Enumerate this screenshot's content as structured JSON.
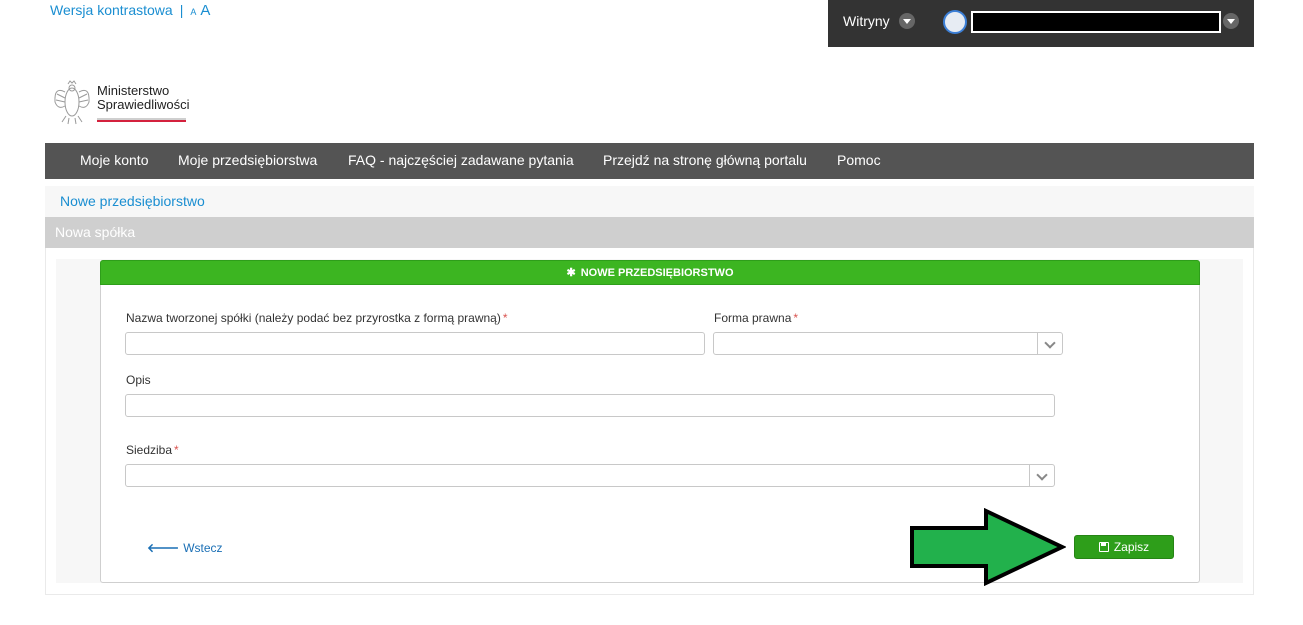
{
  "accessibility": {
    "contrast_label": "Wersja kontrastowa",
    "separator": "|",
    "font_small": "A",
    "font_large": "A"
  },
  "userbar": {
    "sites_label": "Witryny"
  },
  "logo": {
    "line1": "Ministerstwo",
    "line2": "Sprawiedliwości"
  },
  "nav": {
    "items": [
      "Moje konto",
      "Moje przedsiębiorstwa",
      "FAQ - najczęściej zadawane pytania",
      "Przejdź na stronę główną portalu",
      "Pomoc"
    ]
  },
  "breadcrumb": "Nowe przedsiębiorstwo",
  "panel": {
    "title": "Nowa spółka"
  },
  "form": {
    "header": "NOWE PRZEDSIĘBIORSTWO",
    "company_name_label": "Nazwa tworzonej spółki (należy podać bez przyrostka z formą prawną)",
    "company_name_value": "",
    "legal_form_label": "Forma prawna",
    "legal_form_value": "",
    "description_label": "Opis",
    "description_value": "",
    "seat_label": "Siedziba",
    "seat_value": "",
    "required_mark": "*",
    "back_label": "Wstecz",
    "save_label": "Zapisz"
  },
  "colors": {
    "link": "#1a8ed1",
    "navbar": "#545454",
    "userbar": "#333333",
    "card_header": "#3cb521",
    "save_button": "#2e9e1a",
    "annotation_arrow": "#22b14c"
  }
}
